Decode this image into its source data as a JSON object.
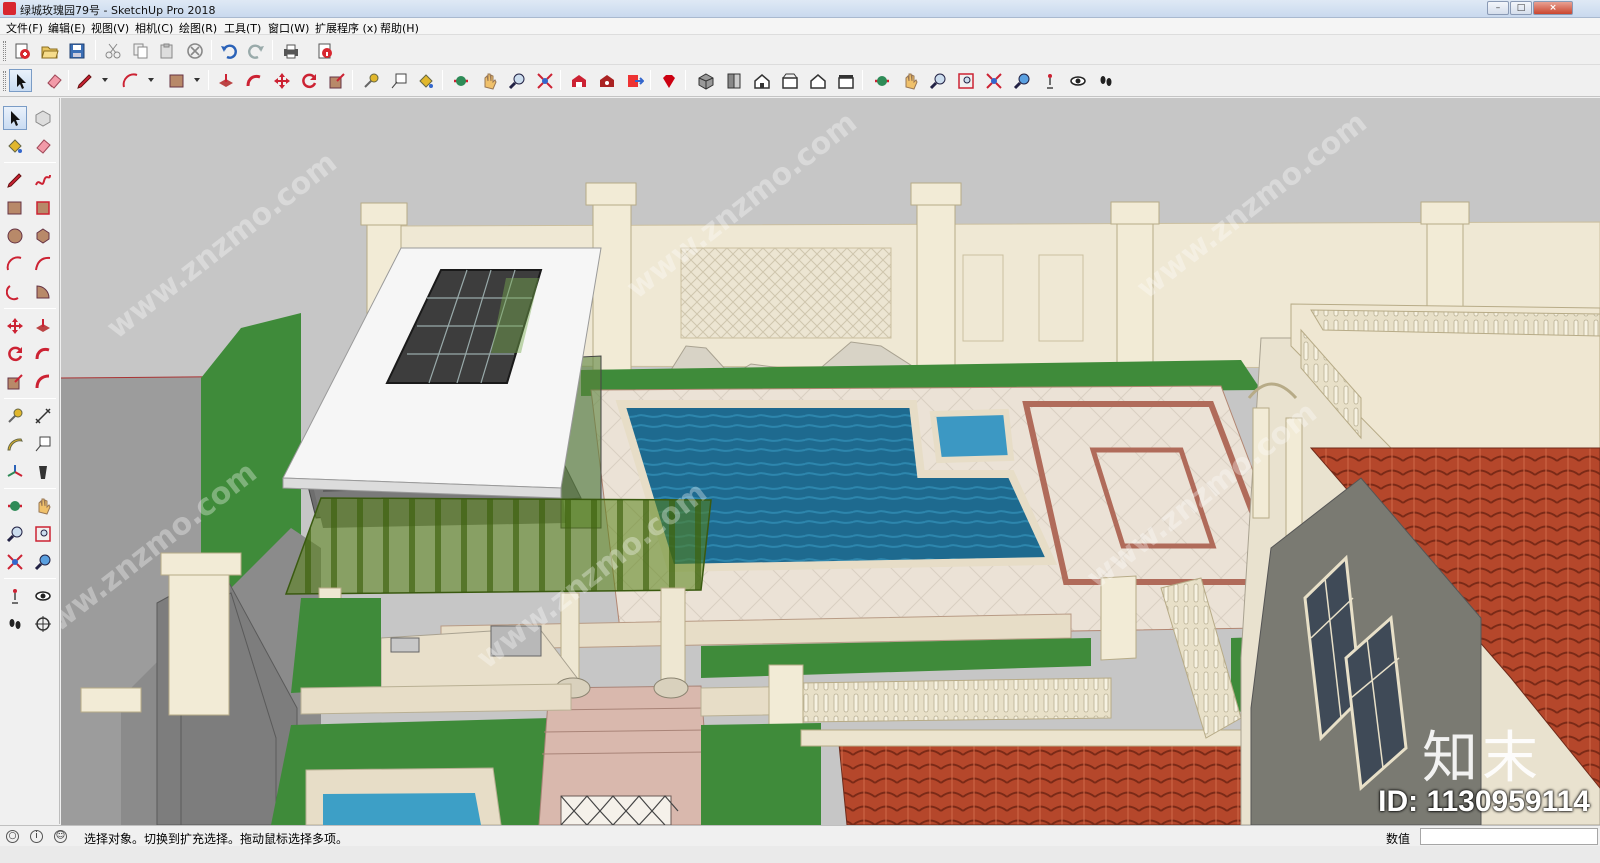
{
  "window": {
    "title": "绿城玫瑰园79号 - SketchUp Pro 2018",
    "buttons": [
      "–",
      "□",
      "×"
    ]
  },
  "menu": {
    "items": [
      "文件(F)",
      "编辑(E)",
      "视图(V)",
      "相机(C)",
      "绘图(R)",
      "工具(T)",
      "窗口(W)",
      "扩展程序 (x)",
      "帮助(H)"
    ]
  },
  "toolbar1": {
    "icons": [
      "new-model-icon",
      "open-icon",
      "save-icon",
      "cut-icon",
      "copy-icon",
      "paste-icon",
      "erase-icon",
      "undo-icon",
      "redo-icon",
      "print-icon",
      "model-info-icon"
    ]
  },
  "toolbar2": {
    "icons": [
      "select-icon",
      "eraser-icon",
      "pencil-line-icon",
      "arc-icon",
      "rectangle-icon",
      "push-pull-icon",
      "follow-me-icon",
      "move-icon",
      "rotate-icon",
      "scale-icon",
      "tape-measure-icon",
      "text-icon",
      "paint-bucket-icon",
      "orbit-icon",
      "pan-icon",
      "zoom-icon",
      "zoom-extents-icon",
      "warehouse-icon",
      "extension-warehouse-icon",
      "send-to-layout-icon",
      "ruby-console-icon",
      "iso-view-icon",
      "top-view-icon",
      "front-view-icon",
      "right-view-icon",
      "back-view-icon",
      "left-view-icon",
      "orbit-icon-2",
      "pan-icon-2",
      "zoom-icon-2",
      "zoom-window-icon",
      "zoom-extents-icon-2",
      "previous-view-icon",
      "position-camera-icon",
      "look-around-icon",
      "walk-icon"
    ],
    "selected": "select-icon"
  },
  "lefttoolbar": {
    "icons": [
      "select-icon",
      "make-component-icon",
      "paint-bucket-icon",
      "eraser-icon",
      "line-icon",
      "freehand-icon",
      "rectangle-icon",
      "rotated-rectangle-icon",
      "circle-icon",
      "polygon-icon",
      "arc-icon",
      "two-point-arc-icon",
      "three-point-arc-icon",
      "pie-icon",
      "move-icon",
      "push-pull-icon",
      "rotate-icon",
      "follow-me-icon",
      "scale-icon",
      "offset-icon",
      "tape-measure-icon",
      "dimension-icon",
      "protractor-icon",
      "text-icon",
      "axes-icon",
      "3d-text-icon",
      "orbit-icon",
      "pan-icon",
      "zoom-icon",
      "zoom-window-icon",
      "zoom-extents-icon",
      "previous-icon",
      "position-camera-icon",
      "look-around-icon",
      "walk-icon",
      "section-plane-icon"
    ],
    "selected": "select-icon"
  },
  "viewport": {
    "watermark": "www.znzmo.com",
    "brand": "知末",
    "id_text": "ID: 1130959114"
  },
  "status": {
    "text": "选择对象。切换到扩充选择。拖动鼠标选择多项。",
    "value_label": "数值",
    "value": ""
  }
}
